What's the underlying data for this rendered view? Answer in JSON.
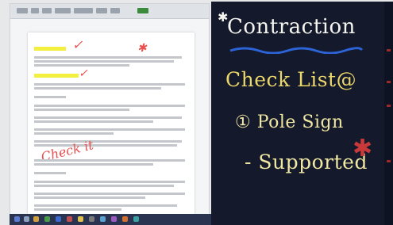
{
  "word": {
    "ribbon_tabs": 10,
    "handwritten_check": "Check it",
    "heading_1": "Q1 / Job Task",
    "heading_2": "Q2 / Job Requirements"
  },
  "board": {
    "title": "Contraction",
    "checklist": "Check List@",
    "item_1": "① Pole Sign",
    "item_2": "- Supported"
  },
  "colors": {
    "board_bg": "#14192b",
    "chalk_white": "#f5f5f0",
    "chalk_yellow": "#ecd76a",
    "highlight": "#f3ef3d",
    "marker_red": "#e85050",
    "underline_blue": "#2c63d6"
  },
  "icons": [
    "star-icon",
    "star-red-icon",
    "checkmark-icon"
  ]
}
